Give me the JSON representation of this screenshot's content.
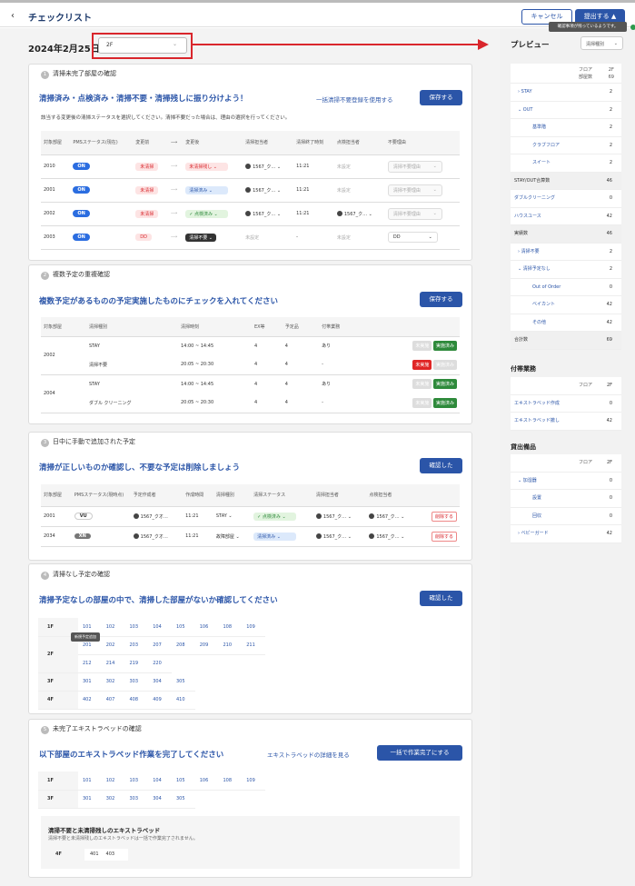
{
  "header": {
    "back": "‹",
    "title": "チェックリスト",
    "cancel": "キャンセル",
    "submit": "提出する",
    "submit_icon": "▲",
    "tooltip": "確認事項が残っているようです。"
  },
  "date": "2024年2月25日",
  "floor": "2F",
  "s1": {
    "num": "1",
    "title": "清掃未完了部屋の確認",
    "heading": "清掃済み・点検済み・清掃不要・清掃残しに振り分けよう！",
    "link": "一括清掃不要登録を使用する",
    "save": "保存する",
    "desc": "該当する変更後の清掃ステータスを選択してください。清掃不要だった場合は、理由の選択を行ってください。",
    "cols": [
      "対象部屋",
      "PMSステータス(現在)",
      "変更前",
      "⟶",
      "変更後",
      "清掃担当者",
      "清掃終了時刻",
      "点検担当者",
      "不要理由"
    ],
    "rows": [
      {
        "room": "2010",
        "pms": "ON",
        "before": "未清掃",
        "after": "未清掃残し",
        "staff": "1567_ク…",
        "time": "11:21",
        "insp": "未設定",
        "reason": "清掃不要理由"
      },
      {
        "room": "2001",
        "pms": "ON",
        "before": "未清掃",
        "after": "清掃済み",
        "staff": "1567_ク…",
        "time": "11:21",
        "insp": "未設定",
        "reason": "清掃不要理由"
      },
      {
        "room": "2002",
        "pms": "ON",
        "before": "未清掃",
        "after": "✓ 点検済み",
        "staff": "1567_ク…",
        "time": "11:21",
        "insp": "1567_ク…",
        "reason": "清掃不要理由"
      },
      {
        "room": "2003",
        "pms": "ON",
        "before": "DD",
        "after": "清掃不要",
        "staff": "未設定",
        "time": "-",
        "insp": "未設定",
        "reason": "DD"
      }
    ]
  },
  "s2": {
    "num": "2",
    "title": "複数予定の重複確認",
    "heading": "複数予定があるものの予定実施したものにチェックを入れてください",
    "save": "保存する",
    "cols": [
      "対象部屋",
      "清掃種別",
      "清掃時刻",
      "EX等",
      "予定品",
      "付帯業務"
    ],
    "groups": [
      {
        "room": "2002",
        "items": [
          {
            "type": "STAY",
            "time": "14:00 ~ 14:45",
            "ex": "4",
            "plan": "4",
            "extra": "あり",
            "a": "未実施",
            "b": "実施済み"
          },
          {
            "type": "清掃不要",
            "time": "20:05 ~ 20:30",
            "ex": "4",
            "plan": "4",
            "extra": "-",
            "a": "未実施",
            "b": "実施済み"
          }
        ]
      },
      {
        "room": "2004",
        "items": [
          {
            "type": "STAY",
            "time": "14:00 ~ 14:45",
            "ex": "4",
            "plan": "4",
            "extra": "あり",
            "a": "未実施",
            "b": "実施済み"
          },
          {
            "type": "ダブル クリーニング",
            "time": "20:05 ~ 20:30",
            "ex": "4",
            "plan": "4",
            "extra": "-",
            "a": "未実施",
            "b": "実施済み"
          }
        ]
      }
    ]
  },
  "s3": {
    "num": "3",
    "title": "日中に手動で追加された予定",
    "heading": "清掃が正しいものか確認し、不要な予定は削除しましょう",
    "confirm": "確認した",
    "cols": [
      "対象部屋",
      "PMSステータス(現時点)",
      "予定作成者",
      "作成時間",
      "清掃種別",
      "清掃ステータス",
      "清掃担当者",
      "点検担当者"
    ],
    "rows": [
      {
        "room": "2001",
        "pms": "VU",
        "creator": "1567_クオ…",
        "time": "11:21",
        "type": "STAY",
        "status": "✓ 点検済み",
        "staff": "1567_ク…",
        "insp": "1567_ク…",
        "del": "削除する"
      },
      {
        "room": "2034",
        "pms": "XN",
        "creator": "1567_クオ…",
        "time": "11:21",
        "type": "故障部屋",
        "status": "清掃済み",
        "staff": "1567_ク…",
        "insp": "1567_ク…",
        "del": "削除する"
      }
    ]
  },
  "s4": {
    "num": "4",
    "title": "清掃なし予定の確認",
    "heading": "清掃予定なしの部屋の中で、清掃した部屋がないか確認してください",
    "confirm": "確認した",
    "tooltip": "新規予定追加",
    "floors": [
      {
        "f": "1F",
        "rooms": [
          "101",
          "102",
          "103",
          "104",
          "105",
          "106",
          "108",
          "109"
        ]
      },
      {
        "f": "2F",
        "rooms": [
          "201",
          "202",
          "203",
          "207",
          "208",
          "209",
          "210",
          "211"
        ],
        "rooms2": [
          "212",
          "214",
          "219",
          "220"
        ]
      },
      {
        "f": "3F",
        "rooms": [
          "301",
          "302",
          "303",
          "304",
          "305"
        ]
      },
      {
        "f": "4F",
        "rooms": [
          "402",
          "407",
          "408",
          "409",
          "410"
        ]
      }
    ]
  },
  "s5": {
    "num": "5",
    "title": "未完了エキストラベッドの確認",
    "heading": "以下部屋のエキストラベッド作業を完了してください",
    "link": "エキストラベッドの詳細を見る",
    "btn": "一括で作業完了にする",
    "floors": [
      {
        "f": "1F",
        "rooms": [
          "101",
          "102",
          "103",
          "104",
          "105",
          "106",
          "108",
          "109"
        ]
      },
      {
        "f": "3F",
        "rooms": [
          "301",
          "302",
          "303",
          "304",
          "305"
        ]
      }
    ],
    "sub_title": "清掃不要と未清掃残しのエキストラベッド",
    "sub_desc": "清掃不要と未清掃残しのエキストラベッドは一括で作業完了されません。",
    "sub_floor": "4F",
    "sub_rooms": [
      "401",
      "403"
    ]
  },
  "preview": {
    "title": "プレビュー",
    "select": "清掃種別",
    "head": {
      "label": "フロア\n部屋数",
      "f": "2F",
      "n": "69"
    },
    "rows": [
      {
        "l": "› STAY",
        "v": "2",
        "ind": 1
      },
      {
        "l": "⌄ OUT",
        "v": "2",
        "ind": 1
      },
      {
        "l": "基準階",
        "v": "2",
        "ind": 3
      },
      {
        "l": "クラブフロア",
        "v": "2",
        "ind": 3
      },
      {
        "l": "スイート",
        "v": "2",
        "ind": 3
      },
      {
        "l": "STAY/OUT合算数",
        "v": "46",
        "gr": 1
      },
      {
        "l": "ダブルクリーニング",
        "v": "0"
      },
      {
        "l": "ハウスユース",
        "v": "42"
      },
      {
        "l": "実績数",
        "v": "46",
        "gr": 1
      },
      {
        "l": "› 清掃不要",
        "v": "2",
        "ind": 1
      },
      {
        "l": "⌄ 清掃予定なし",
        "v": "2",
        "ind": 1
      },
      {
        "l": "Out of Order",
        "v": "0",
        "ind": 3
      },
      {
        "l": "ベイカント",
        "v": "42",
        "ind": 3
      },
      {
        "l": "その他",
        "v": "42",
        "ind": 3
      },
      {
        "l": "合計数",
        "v": "69",
        "gr": 1
      }
    ],
    "s2": {
      "title": "付帯業務",
      "hl": "フロア",
      "hv": "2F",
      "rows": [
        {
          "l": "エキストラベッド作成",
          "v": "0"
        },
        {
          "l": "エキストラベッド撤し",
          "v": "42"
        }
      ]
    },
    "s3": {
      "title": "貸出備品",
      "hl": "フロア",
      "hv": "2F",
      "rows": [
        {
          "l": "⌄ 加湿器",
          "v": "0",
          "ind": 1
        },
        {
          "l": "設置",
          "v": "0",
          "ind": 3
        },
        {
          "l": "回収",
          "v": "0",
          "ind": 3
        },
        {
          "l": "› ベビーガード",
          "v": "42",
          "ind": 1
        }
      ]
    }
  }
}
